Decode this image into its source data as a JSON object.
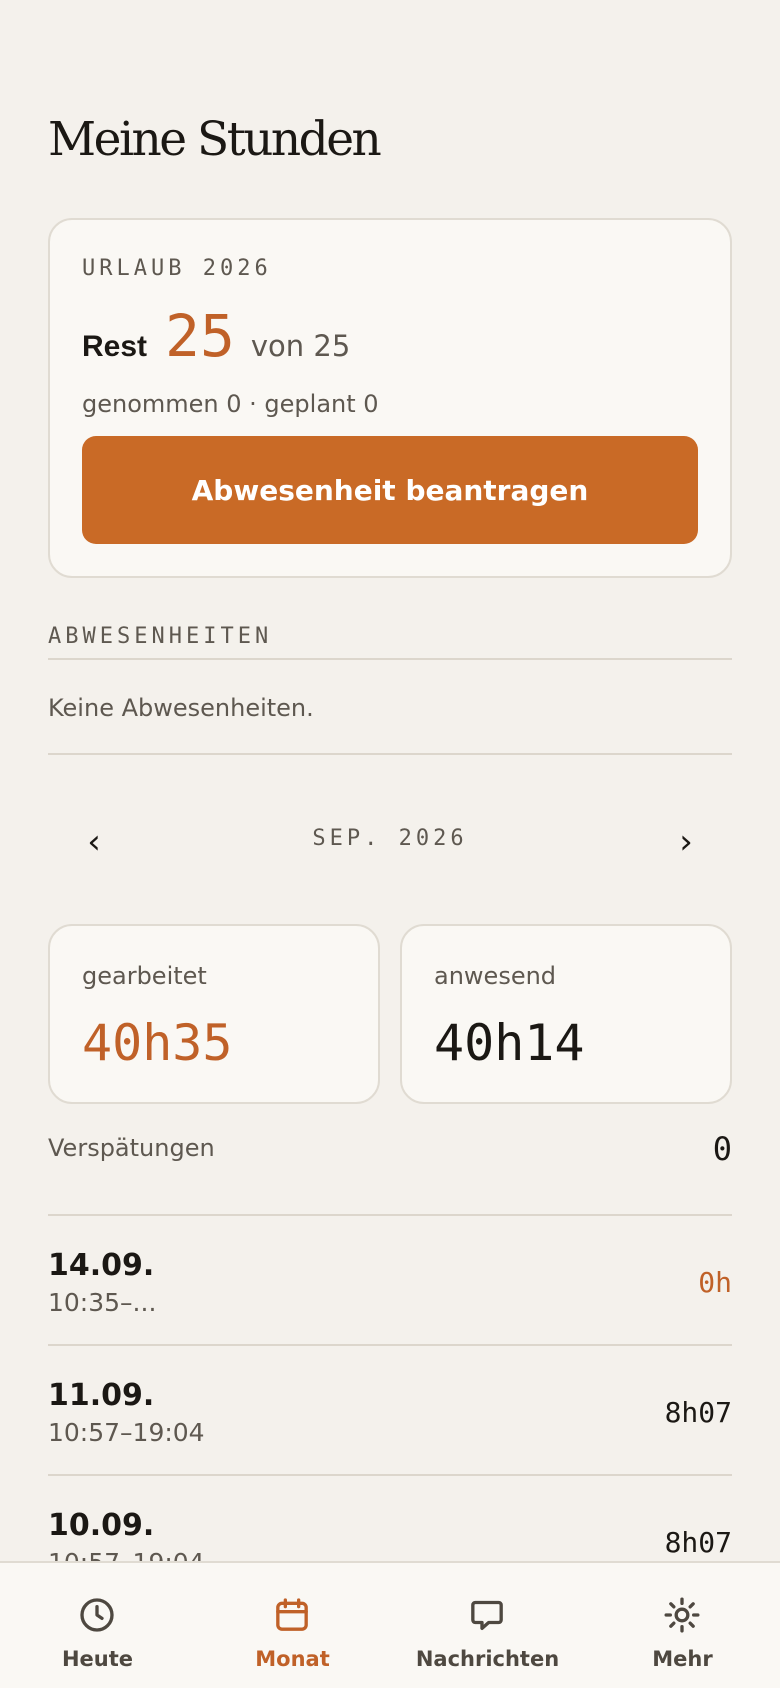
{
  "header": {
    "title": "Meine Stunden"
  },
  "vacation": {
    "eyebrow": "URLAUB 2026",
    "rest_label": "Rest",
    "rest_value": "25",
    "rest_of": "von 25",
    "summary": "genommen 0 · geplant 0",
    "request_button": "Abwesenheit beantragen"
  },
  "absences": {
    "title": "ABWESENHEITEN",
    "empty_text": "Keine Abwesenheiten."
  },
  "month_nav": {
    "prev": "‹",
    "label": "SEP. 2026",
    "next": "›"
  },
  "stats": {
    "worked_label": "gearbeitet",
    "worked_value": "40h35",
    "present_label": "anwesend",
    "present_value": "40h14"
  },
  "lateness": {
    "label": "Verspätungen",
    "value": "0"
  },
  "entries": [
    {
      "date": "14.09.",
      "time": "10:35–...",
      "hours": "0h"
    },
    {
      "date": "11.09.",
      "time": "10:57–19:04",
      "hours": "8h07"
    },
    {
      "date": "10.09.",
      "time": "10:57–19:04",
      "hours": "8h07"
    }
  ],
  "tabbar": {
    "items": [
      {
        "label": "Heute",
        "icon": "clock-icon"
      },
      {
        "label": "Monat",
        "icon": "calendar-icon"
      },
      {
        "label": "Nachrichten",
        "icon": "chat-bubble-icon"
      },
      {
        "label": "Mehr",
        "icon": "sun-icon"
      }
    ],
    "active": "Monat"
  },
  "colors": {
    "accent": "#c96a26",
    "background": "#f4f1ec",
    "card": "#faf8f4"
  }
}
